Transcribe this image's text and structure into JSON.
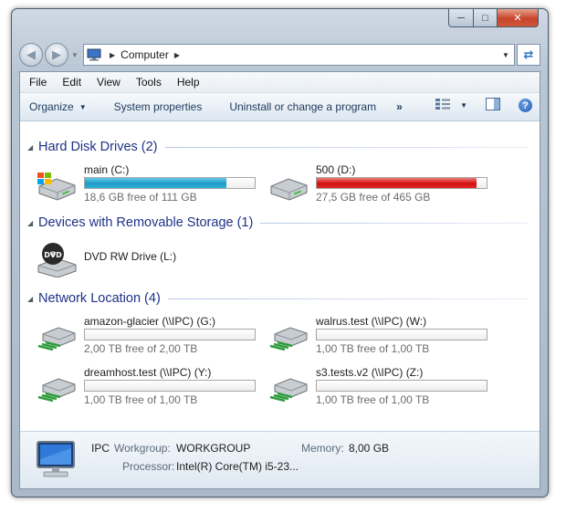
{
  "window": {
    "address_crumb": "Computer",
    "menu": [
      "File",
      "Edit",
      "View",
      "Tools",
      "Help"
    ],
    "toolbar": {
      "organize": "Organize",
      "system_properties": "System properties",
      "uninstall": "Uninstall or change a program",
      "more": "»"
    }
  },
  "groups": [
    {
      "title": "Hard Disk Drives (2)",
      "drives": [
        {
          "name": "main (C:)",
          "free_text": "18,6 GB free of 111 GB",
          "used_fraction": 0.832,
          "bar_color": "#1e9bc6"
        },
        {
          "name": "500 (D:)",
          "free_text": "27,5 GB free of 465 GB",
          "used_fraction": 0.941,
          "bar_color": "#d10f0f"
        }
      ]
    },
    {
      "title": "Devices with Removable Storage (1)",
      "drives": [
        {
          "name": "DVD RW Drive (L:)",
          "icon_label": "DVD"
        }
      ]
    },
    {
      "title": "Network Location (4)",
      "drives": [
        {
          "name": "amazon-glacier (\\\\IPC) (G:)",
          "free_text": "2,00 TB free of 2,00 TB",
          "used_fraction": 0
        },
        {
          "name": "walrus.test (\\\\IPC) (W:)",
          "free_text": "1,00 TB free of 1,00 TB",
          "used_fraction": 0
        },
        {
          "name": "dreamhost.test (\\\\IPC) (Y:)",
          "free_text": "1,00 TB free of 1,00 TB",
          "used_fraction": 0
        },
        {
          "name": "s3.tests.v2 (\\\\IPC) (Z:)",
          "free_text": "1,00 TB free of 1,00 TB",
          "used_fraction": 0
        }
      ]
    }
  ],
  "details": {
    "computer_name": "IPC",
    "workgroup_label": "Workgroup:",
    "workgroup": "WORKGROUP",
    "memory_label": "Memory:",
    "memory": "8,00 GB",
    "processor_label": "Processor:",
    "processor": "Intel(R) Core(TM) i5-23..."
  },
  "colors": {
    "group_title": "#1e3287",
    "command_text": "#1e395b",
    "free_text": "#6d6d6d"
  }
}
